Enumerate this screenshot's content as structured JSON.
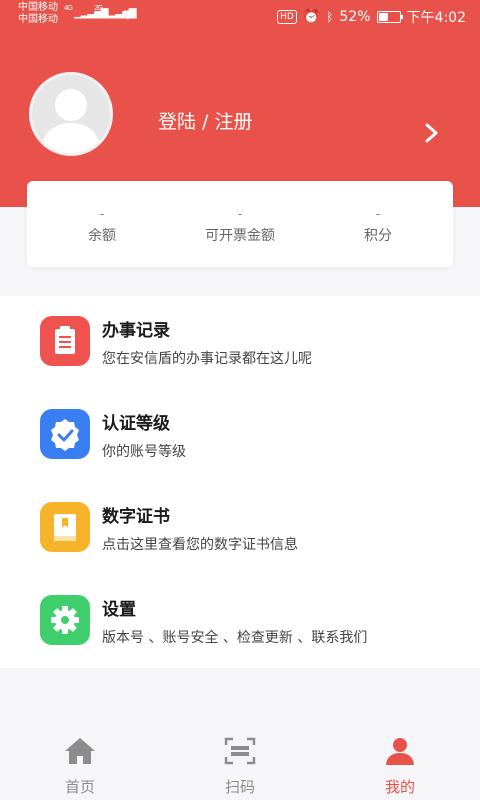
{
  "status_bar": {
    "carrier1": "中国移动",
    "carrier2": "中国移动",
    "net1": "4G",
    "net2": "2G",
    "hd": "HD",
    "battery": "52%",
    "battery_level": 0.52,
    "time": "下午4:02"
  },
  "profile": {
    "login_label": "登陆 / 注册"
  },
  "stats": [
    {
      "value": "-",
      "label": "余额"
    },
    {
      "value": "-",
      "label": "可开票金额"
    },
    {
      "value": "-",
      "label": "积分"
    }
  ],
  "menu": [
    {
      "title": "办事记录",
      "subtitle": "您在安信盾的办事记录都在这儿呢",
      "icon": "clipboard-icon",
      "color": "#f0524f"
    },
    {
      "title": "认证等级",
      "subtitle": "你的账号等级",
      "icon": "verified-badge-icon",
      "color": "#3a7ff2"
    },
    {
      "title": "数字证书",
      "subtitle": "点击这里查看您的数字证书信息",
      "icon": "certificate-book-icon",
      "color": "#f7b329"
    },
    {
      "title": "设置",
      "subtitle": "版本号 、账号安全 、检查更新 、联系我们",
      "icon": "gear-icon",
      "color": "#3fcf6d"
    }
  ],
  "nav": [
    {
      "label": "首页",
      "icon": "home-icon",
      "active": false
    },
    {
      "label": "扫码",
      "icon": "scan-icon",
      "active": false
    },
    {
      "label": "我的",
      "icon": "person-icon",
      "active": true
    }
  ],
  "colors": {
    "brand": "#e8524a",
    "nav_inactive": "#8c8c8c",
    "nav_active": "#e8524a"
  }
}
